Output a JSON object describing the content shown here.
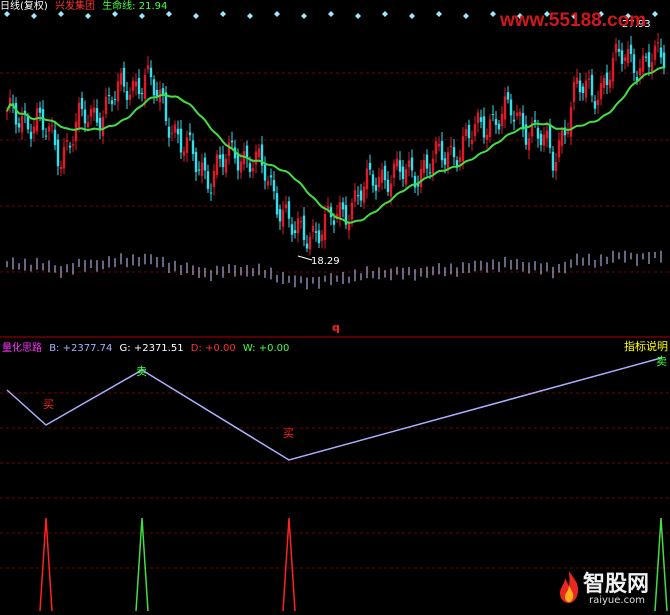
{
  "colors": {
    "background": "#000000",
    "bull": "#e0182a",
    "bear": "#30e0ec",
    "ma_line": "#44dd44",
    "volume_bar": "#ccccff",
    "grid": "#7a0000",
    "divider": "#b00000",
    "quant_line": "#aab0ff",
    "title_magenta": "#ff33ff",
    "value_b": "#aab0ff",
    "value_g": "#ffffff",
    "value_d": "#ff3333",
    "value_w": "#44ff44",
    "buy_mark": "#ff2222",
    "sell_mark": "#44ff44",
    "diamond": "#9fe9ff",
    "spike_red": "#ff2222",
    "spike_green": "#44dd44",
    "button_yellow": "#ffff00"
  },
  "top_header": {
    "period_label": "日线(复权)",
    "stock_name": "兴发集团",
    "indicator_label": "生命线:",
    "indicator_value": "21.94"
  },
  "price_labels": {
    "high": "27.93",
    "low": "18.29"
  },
  "mid_marker": "q",
  "lower_panel": {
    "title": "量化思路",
    "b_label": "B:",
    "b_value": "+2377.74",
    "g_label": "G:",
    "g_value": "+2371.51",
    "d_label": "D:",
    "d_value": "+0.00",
    "w_label": "W:",
    "w_value": "+0.00",
    "help_button": "指标说明"
  },
  "signals": {
    "buy": "买",
    "sell": "卖"
  },
  "watermarks": {
    "site": "www.55188.com",
    "brand": "智股网",
    "domain": "raiyue.com"
  },
  "chart_data": {
    "type": "candlestick",
    "y_unit": "price",
    "marked_high": 27.93,
    "marked_low": 18.29,
    "ma_line_name": "生命线",
    "ma_last_value": 21.94,
    "quant_line": [
      {
        "bar": 0,
        "value": 0.8
      },
      {
        "bar": 13,
        "value": 0.45
      },
      {
        "bar": 45,
        "value": 1.0
      },
      {
        "bar": 94,
        "value": 0.1
      },
      {
        "bar": 218,
        "value": 1.12
      }
    ],
    "signal_points": [
      {
        "bar": 13,
        "signal": "buy"
      },
      {
        "bar": 45,
        "signal": "sell"
      },
      {
        "bar": 94,
        "signal": "buy"
      },
      {
        "bar": 218,
        "signal": "sell"
      }
    ]
  }
}
